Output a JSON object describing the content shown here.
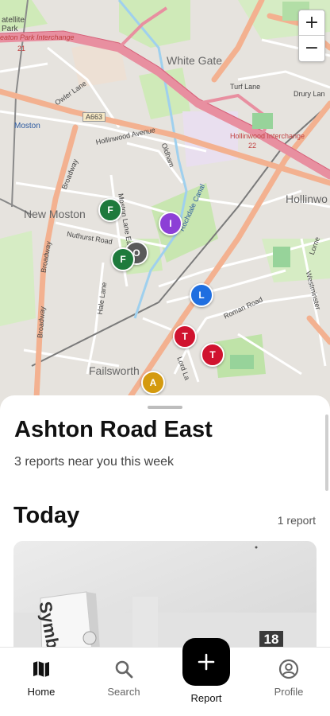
{
  "map": {
    "zoom_in": "+",
    "zoom_out": "−",
    "labels": {
      "satellite_park": "atellite\nPark",
      "heaton_park_interchange": "eaton Park Interchange",
      "junction_21": "21",
      "white_gate": "White Gate",
      "turf_lane": "Turf Lane",
      "drury_lane": "Drury Lan",
      "owler_lane": "Owler Lane",
      "a663": "A663",
      "moston": "Moston",
      "hollinwood_avenue": "Hollinwood Avenue",
      "oldham": "Oldham",
      "hollinwood_interchange": "Hollinwood Interchange",
      "junction_22": "22",
      "broadway_top": "Broadway",
      "hollinwo": "Hollinwo",
      "new_moston": "New Moston",
      "nuthurst_road": "Nuthurst Road",
      "moston_lane_east": "Moston Lane East",
      "rochdale_canal": "Rochdale Canal",
      "broadway_left": "Broadway",
      "hale_lane": "Hale Lane",
      "roman_road": "Roman Road",
      "westminster": "Westminster",
      "broadway_bottom": "Broadway",
      "failsworth": "Failsworth",
      "lord_lane": "Lord La",
      "lorne": "Lorne"
    },
    "markers": [
      {
        "letter": "F",
        "color": "#1e7a3c"
      },
      {
        "letter": "I",
        "color": "#8c3fd6"
      },
      {
        "letter": "O",
        "color": "#5a5a5a"
      },
      {
        "letter": "F",
        "color": "#1e7a3c"
      },
      {
        "letter": "L",
        "color": "#1f6ee0"
      },
      {
        "letter": "T",
        "color": "#d0132f"
      },
      {
        "letter": "T",
        "color": "#d0132f"
      },
      {
        "letter": "A",
        "color": "#d49a0f"
      }
    ]
  },
  "sheet": {
    "title": "Ashton Road East",
    "subtitle": "3 reports near you this week",
    "section_title": "Today",
    "section_count": "1 report",
    "card": {
      "product_text": "Symb",
      "box_number": "18"
    }
  },
  "tabs": {
    "home": "Home",
    "search": "Search",
    "report": "Report",
    "profile": "Profile"
  },
  "icons": {
    "home": "map-icon",
    "search": "search-icon",
    "report": "plus-icon",
    "profile": "user-circle-icon"
  },
  "colors": {
    "accent": "#000000",
    "motorway": "#e88fa0",
    "primary_road": "#f3b190",
    "park": "#cfeab8",
    "canal": "#9fd0ee"
  }
}
